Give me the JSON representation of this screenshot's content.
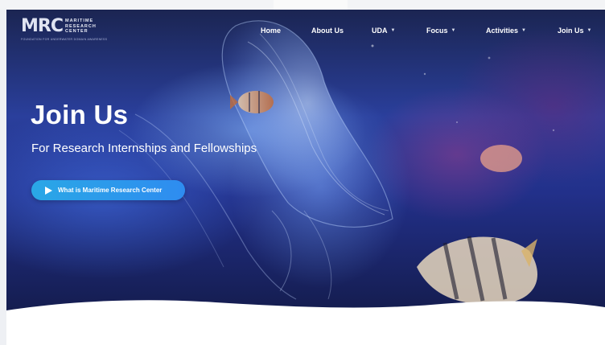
{
  "logo": {
    "mark": "MRC",
    "words": [
      "MARITIME",
      "RESEARCH",
      "CENTER"
    ],
    "tagline": "FOUNDATION FOR UNDERWATER DOMAIN AWARENESS"
  },
  "nav": {
    "items": [
      {
        "label": "Home",
        "dropdown": false
      },
      {
        "label": "About Us",
        "dropdown": false
      },
      {
        "label": "UDA",
        "dropdown": true
      },
      {
        "label": "Focus",
        "dropdown": true
      },
      {
        "label": "Activities",
        "dropdown": true
      },
      {
        "label": "Join Us",
        "dropdown": true
      }
    ]
  },
  "hero": {
    "title": "Join Us",
    "subtitle": "For Research Internships and Fellowships",
    "cta_label": "What is Maritime Research Center"
  },
  "icons": {
    "play": "play-icon",
    "chevron": "chevron-down-icon"
  },
  "colors": {
    "cta": "#2e8cf0",
    "hero_bg": "#22308a",
    "text": "#ffffff"
  }
}
